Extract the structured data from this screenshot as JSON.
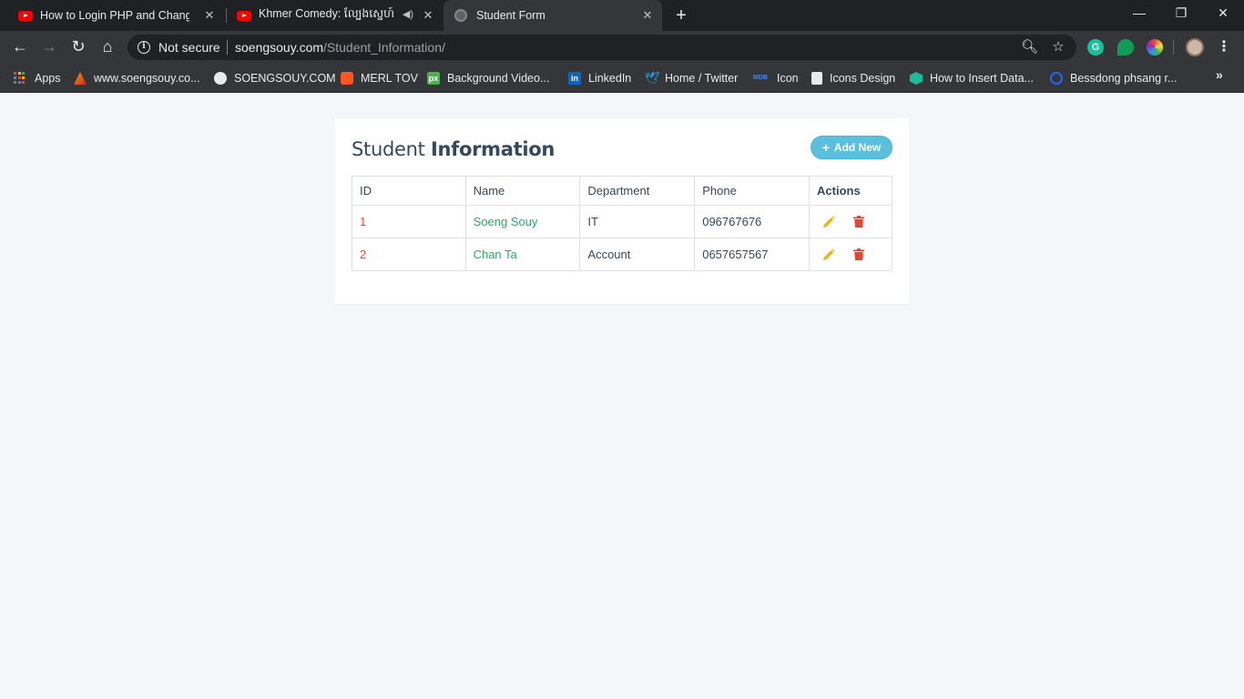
{
  "browser": {
    "tabs": [
      {
        "title": "How to Login PHP and Change M",
        "icon": "youtube-icon"
      },
      {
        "title": "Khmer Comedy: ល្បែងស្នេហ៍ន",
        "icon": "youtube-icon",
        "audio": true
      },
      {
        "title": "Student Form",
        "icon": "globe-icon",
        "active": true
      }
    ],
    "security_label": "Not secure",
    "url_domain": "soengsouy.com",
    "url_path": "/Student_Information/",
    "bookmarks": [
      {
        "label": "Apps",
        "icon": "apps-grid-icon"
      },
      {
        "label": "www.soengsouy.co...",
        "icon": "site-icon"
      },
      {
        "label": "SOENGSOUY.COM",
        "icon": "globe-icon"
      },
      {
        "label": "MERL TOV",
        "icon": "blogger-icon"
      },
      {
        "label": "Background Video...",
        "icon": "pixabay-icon"
      },
      {
        "label": "LinkedIn",
        "icon": "linkedin-icon"
      },
      {
        "label": "Home / Twitter",
        "icon": "twitter-icon"
      },
      {
        "label": "Icon",
        "icon": "mdb-icon"
      },
      {
        "label": "Icons Design",
        "icon": "document-icon"
      },
      {
        "label": "How to Insert Data...",
        "icon": "cube-icon"
      },
      {
        "label": "Bessdong phsang r...",
        "icon": "play-circle-icon"
      }
    ],
    "extension_grammarly": "G"
  },
  "page": {
    "title_light": "Student",
    "title_bold": "Information",
    "add_button_label": "Add New",
    "table": {
      "headers": {
        "id": "ID",
        "name": "Name",
        "department": "Department",
        "phone": "Phone",
        "actions": "Actions"
      },
      "rows": [
        {
          "id": "1",
          "name": "Soeng Souy",
          "department": "IT",
          "phone": "096767676"
        },
        {
          "id": "2",
          "name": "Chan Ta",
          "department": "Account",
          "phone": "0657657567"
        }
      ]
    }
  },
  "colors": {
    "info_button": "#5bc0de",
    "id_text": "#e74c3c",
    "name_text": "#27ae60",
    "edit_icon": "#f5b400",
    "delete_icon": "#e8452c"
  }
}
